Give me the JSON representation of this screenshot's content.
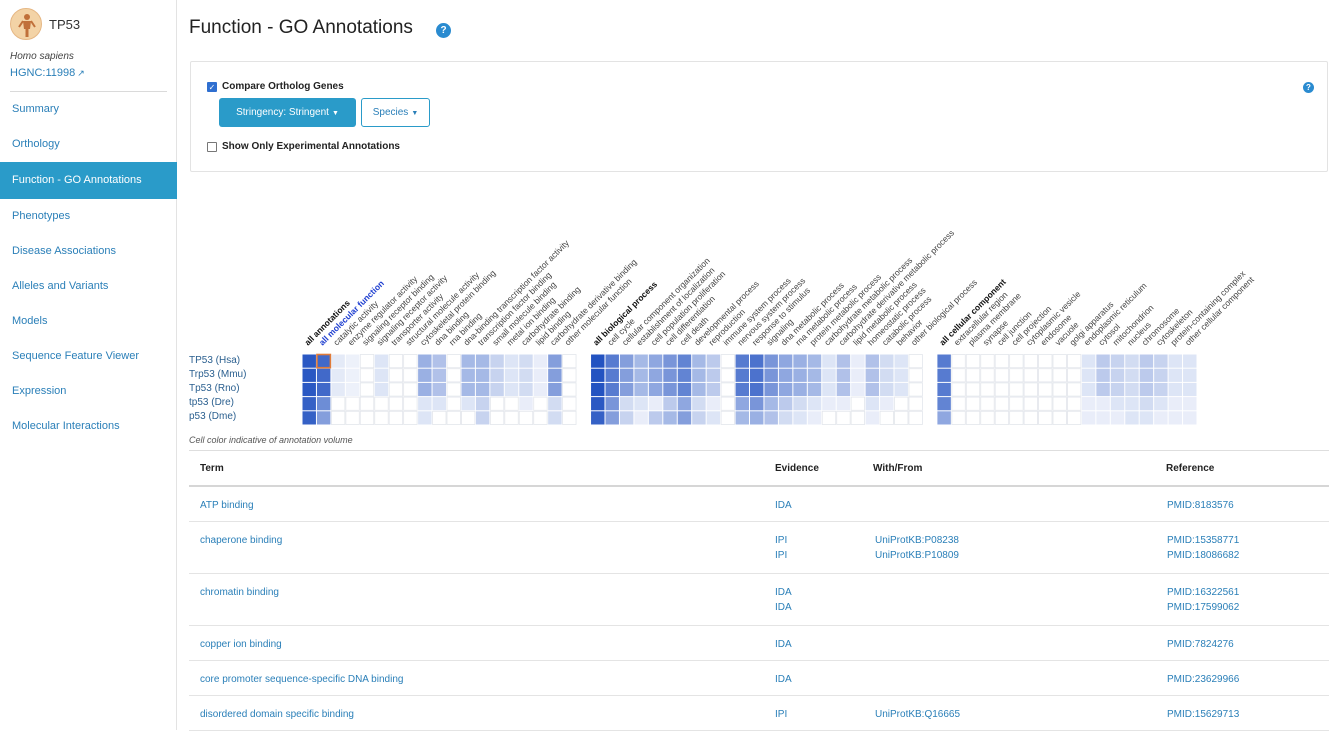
{
  "sidebar": {
    "gene_symbol": "TP53",
    "species": "Homo sapiens",
    "hgnc_id": "HGNC:11998",
    "nav": [
      {
        "label": "Summary",
        "active": false
      },
      {
        "label": "Orthology",
        "active": false
      },
      {
        "label": "Function - GO Annotations",
        "active": true
      },
      {
        "label": "Phenotypes",
        "active": false
      },
      {
        "label": "Disease Associations",
        "active": false
      },
      {
        "label": "Alleles and Variants",
        "active": false
      },
      {
        "label": "Models",
        "active": false
      },
      {
        "label": "Sequence Feature Viewer",
        "active": false
      },
      {
        "label": "Expression",
        "active": false
      },
      {
        "label": "Molecular Interactions",
        "active": false
      }
    ]
  },
  "header": {
    "title": "Function - GO Annotations"
  },
  "controls": {
    "compare_label": "Compare Ortholog Genes",
    "compare_checked": true,
    "stringency_label": "Stringency: Stringent",
    "species_label": "Species",
    "experimental_label": "Show Only Experimental Annotations",
    "experimental_checked": false
  },
  "ribbon": {
    "colors": {
      "max": "#1f4fc0",
      "min": "#ffffff",
      "highlight_border": "#e07b39",
      "empty_border": "#e3e6ec"
    },
    "species_rows": [
      "TP53 (Hsa)",
      "Trp53 (Mmu)",
      "Tp53 (Rno)",
      "tp53 (Dre)",
      "p53 (Dme)"
    ],
    "groups": [
      {
        "label": "all annotations",
        "kind": "all",
        "values": [
          0.95,
          0.95,
          0.95,
          0.9,
          0.9
        ]
      },
      {
        "label": "all molecular function",
        "kind": "all-mf",
        "values": [
          0.85,
          0.85,
          0.85,
          0.65,
          0.55
        ]
      },
      {
        "label": "catalytic activity",
        "kind": "term",
        "values": [
          0.12,
          0.12,
          0.12,
          0,
          0
        ]
      },
      {
        "label": "enzyme regulator activity",
        "kind": "term",
        "values": [
          0.08,
          0.08,
          0.08,
          0,
          0
        ]
      },
      {
        "label": "signaling receptor binding",
        "kind": "term",
        "values": [
          0,
          0,
          0,
          0,
          0
        ]
      },
      {
        "label": "signaling receptor activity",
        "kind": "term",
        "values": [
          0.15,
          0.15,
          0.15,
          0,
          0
        ]
      },
      {
        "label": "transporter activity",
        "kind": "term",
        "values": [
          0,
          0,
          0,
          0,
          0
        ]
      },
      {
        "label": "structural molecule activity",
        "kind": "term",
        "values": [
          0,
          0,
          0,
          0,
          0
        ]
      },
      {
        "label": "cytoskeletal protein binding",
        "kind": "term",
        "values": [
          0.45,
          0.45,
          0.45,
          0.15,
          0.15
        ]
      },
      {
        "label": "dna binding",
        "kind": "term",
        "values": [
          0.35,
          0.35,
          0.35,
          0.15,
          0
        ]
      },
      {
        "label": "rna binding",
        "kind": "term",
        "values": [
          0,
          0,
          0,
          0,
          0
        ]
      },
      {
        "label": "dna-binding transcription factor activity",
        "kind": "term",
        "values": [
          0.4,
          0.4,
          0.4,
          0.15,
          0
        ]
      },
      {
        "label": "transcription factor binding",
        "kind": "term",
        "values": [
          0.4,
          0.4,
          0.4,
          0.25,
          0.25
        ]
      },
      {
        "label": "small molecule binding",
        "kind": "term",
        "values": [
          0.25,
          0.25,
          0.25,
          0,
          0
        ]
      },
      {
        "label": "metal ion binding",
        "kind": "term",
        "values": [
          0.15,
          0.15,
          0.15,
          0,
          0
        ]
      },
      {
        "label": "carbohydrate binding",
        "kind": "term",
        "values": [
          0.2,
          0.2,
          0.2,
          0.1,
          0
        ]
      },
      {
        "label": "lipid binding",
        "kind": "term",
        "values": [
          0.1,
          0.1,
          0.1,
          0,
          0
        ]
      },
      {
        "label": "carbohydrate derivative binding",
        "kind": "term",
        "values": [
          0.55,
          0.55,
          0.55,
          0.2,
          0.2
        ]
      },
      {
        "label": "other molecular function",
        "kind": "term",
        "values": [
          0,
          0,
          0,
          0,
          0
        ]
      },
      {
        "label": "all biological process",
        "kind": "all-bp",
        "values": [
          0.98,
          0.98,
          0.98,
          0.95,
          0.9
        ]
      },
      {
        "label": "cell cycle",
        "kind": "term",
        "values": [
          0.75,
          0.75,
          0.75,
          0.6,
          0.55
        ]
      },
      {
        "label": "cellular component organization",
        "kind": "term",
        "values": [
          0.55,
          0.55,
          0.55,
          0.2,
          0.25
        ]
      },
      {
        "label": "establishment of localization",
        "kind": "term",
        "values": [
          0.4,
          0.4,
          0.4,
          0.15,
          0.1
        ]
      },
      {
        "label": "cell population proliferation",
        "kind": "term",
        "values": [
          0.5,
          0.5,
          0.5,
          0.1,
          0.3
        ]
      },
      {
        "label": "cell differentiation",
        "kind": "term",
        "values": [
          0.6,
          0.6,
          0.6,
          0.3,
          0.4
        ]
      },
      {
        "label": "cell death",
        "kind": "term",
        "values": [
          0.7,
          0.7,
          0.7,
          0.5,
          0.55
        ]
      },
      {
        "label": "developmental process",
        "kind": "term",
        "values": [
          0.4,
          0.4,
          0.4,
          0.2,
          0.25
        ]
      },
      {
        "label": "reproduction",
        "kind": "term",
        "values": [
          0.3,
          0.3,
          0.3,
          0.1,
          0.15
        ]
      },
      {
        "label": "immune system process",
        "kind": "term",
        "values": [
          0,
          0,
          0,
          0,
          0
        ]
      },
      {
        "label": "nervous system process",
        "kind": "term",
        "values": [
          0.75,
          0.75,
          0.75,
          0.5,
          0.4
        ]
      },
      {
        "label": "response to stimulus",
        "kind": "term",
        "values": [
          0.8,
          0.8,
          0.8,
          0.6,
          0.45
        ]
      },
      {
        "label": "signaling",
        "kind": "term",
        "values": [
          0.6,
          0.6,
          0.6,
          0.4,
          0.35
        ]
      },
      {
        "label": "dna metabolic process",
        "kind": "term",
        "values": [
          0.5,
          0.5,
          0.5,
          0.3,
          0.2
        ]
      },
      {
        "label": "rna metabolic process",
        "kind": "term",
        "values": [
          0.45,
          0.45,
          0.45,
          0.2,
          0.15
        ]
      },
      {
        "label": "protein metabolic process",
        "kind": "term",
        "values": [
          0.4,
          0.4,
          0.4,
          0.15,
          0.1
        ]
      },
      {
        "label": "carbohydrate metabolic process",
        "kind": "term",
        "values": [
          0.15,
          0.15,
          0.15,
          0.1,
          0
        ]
      },
      {
        "label": "carbohydrate derivative metabolic process",
        "kind": "term",
        "values": [
          0.35,
          0.35,
          0.35,
          0.1,
          0
        ]
      },
      {
        "label": "lipid metabolic process",
        "kind": "term",
        "values": [
          0.1,
          0.1,
          0.1,
          0,
          0
        ]
      },
      {
        "label": "homeostatic process",
        "kind": "term",
        "values": [
          0.35,
          0.35,
          0.35,
          0.15,
          0.1
        ]
      },
      {
        "label": "catabolic process",
        "kind": "term",
        "values": [
          0.2,
          0.2,
          0.2,
          0.1,
          0
        ]
      },
      {
        "label": "behavior",
        "kind": "term",
        "values": [
          0.15,
          0.15,
          0.15,
          0,
          0
        ]
      },
      {
        "label": "other biological process",
        "kind": "term",
        "values": [
          0,
          0,
          0,
          0,
          0
        ]
      },
      {
        "label": "all cellular component",
        "kind": "all-cc",
        "values": [
          0.75,
          0.75,
          0.75,
          0.7,
          0.5
        ]
      },
      {
        "label": "extracellular region",
        "kind": "term",
        "values": [
          0,
          0,
          0,
          0,
          0
        ]
      },
      {
        "label": "plasma membrane",
        "kind": "term",
        "values": [
          0,
          0,
          0,
          0,
          0
        ]
      },
      {
        "label": "synapse",
        "kind": "term",
        "values": [
          0,
          0,
          0,
          0,
          0
        ]
      },
      {
        "label": "cell junction",
        "kind": "term",
        "values": [
          0,
          0,
          0,
          0,
          0
        ]
      },
      {
        "label": "cell projection",
        "kind": "term",
        "values": [
          0,
          0,
          0,
          0,
          0
        ]
      },
      {
        "label": "cytoplasmic vesicle",
        "kind": "term",
        "values": [
          0,
          0,
          0,
          0,
          0
        ]
      },
      {
        "label": "endosome",
        "kind": "term",
        "values": [
          0,
          0,
          0,
          0,
          0
        ]
      },
      {
        "label": "vacuole",
        "kind": "term",
        "values": [
          0,
          0,
          0,
          0,
          0
        ]
      },
      {
        "label": "golgi apparatus",
        "kind": "term",
        "values": [
          0,
          0,
          0,
          0,
          0
        ]
      },
      {
        "label": "endoplasmic reticulum",
        "kind": "term",
        "values": [
          0.15,
          0.15,
          0.15,
          0.1,
          0.1
        ]
      },
      {
        "label": "cytosol",
        "kind": "term",
        "values": [
          0.3,
          0.3,
          0.3,
          0.1,
          0.1
        ]
      },
      {
        "label": "mitochondrion",
        "kind": "term",
        "values": [
          0.25,
          0.25,
          0.25,
          0.15,
          0.1
        ]
      },
      {
        "label": "nucleus",
        "kind": "term",
        "values": [
          0.2,
          0.2,
          0.2,
          0.15,
          0.15
        ]
      },
      {
        "label": "chromosome",
        "kind": "term",
        "values": [
          0.3,
          0.3,
          0.3,
          0.2,
          0.15
        ]
      },
      {
        "label": "cytoskeleton",
        "kind": "term",
        "values": [
          0.25,
          0.25,
          0.25,
          0.15,
          0.1
        ]
      },
      {
        "label": "protein-containing complex",
        "kind": "term",
        "values": [
          0.15,
          0.15,
          0.15,
          0.1,
          0.1
        ]
      },
      {
        "label": "other cellular component",
        "kind": "term",
        "values": [
          0.15,
          0.15,
          0.15,
          0.1,
          0.1
        ]
      }
    ],
    "legend_text": "Cell color indicative of annotation volume"
  },
  "table": {
    "headers": {
      "term": "Term",
      "evidence": "Evidence",
      "with_from": "With/From",
      "reference": "Reference"
    },
    "rows": [
      {
        "term": "ATP binding",
        "evidence": [
          "IDA"
        ],
        "with_from": [],
        "reference": [
          "PMID:8183576"
        ]
      },
      {
        "term": "chaperone binding",
        "evidence": [
          "IPI",
          "IPI"
        ],
        "with_from": [
          "UniProtKB:P08238",
          "UniProtKB:P10809"
        ],
        "reference": [
          "PMID:15358771",
          "PMID:18086682"
        ]
      },
      {
        "term": "chromatin binding",
        "evidence": [
          "IDA",
          "IDA"
        ],
        "with_from": [],
        "reference": [
          "PMID:16322561",
          "PMID:17599062"
        ]
      },
      {
        "term": "copper ion binding",
        "evidence": [
          "IDA"
        ],
        "with_from": [],
        "reference": [
          "PMID:7824276"
        ]
      },
      {
        "term": "core promoter sequence-specific DNA binding",
        "evidence": [
          "IDA"
        ],
        "with_from": [],
        "reference": [
          "PMID:23629966"
        ]
      },
      {
        "term": "disordered domain specific binding",
        "evidence": [
          "IPI"
        ],
        "with_from": [
          "UniProtKB:Q16665"
        ],
        "reference": [
          "PMID:15629713"
        ]
      }
    ]
  }
}
